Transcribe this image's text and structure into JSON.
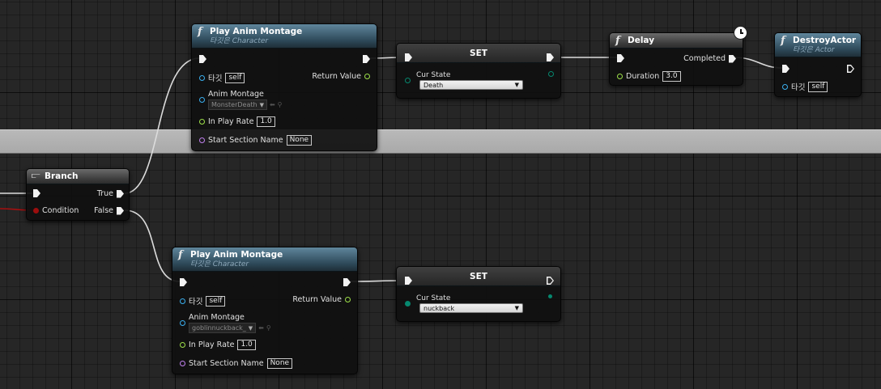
{
  "pins": {
    "target": "타깃",
    "self": "self",
    "anim_montage": "Anim Montage",
    "in_play_rate": "In Play Rate",
    "start_section_name": "Start Section Name",
    "return_value": "Return Value",
    "cur_state": "Cur State",
    "condition": "Condition",
    "true": "True",
    "false": "False",
    "duration": "Duration",
    "completed": "Completed"
  },
  "nodes": {
    "play_montage_top": {
      "title": "Play Anim Montage",
      "subtitle": "타깃은 Character",
      "montage": "MonsterDeath",
      "rate": "1.0",
      "section": "None"
    },
    "set_top": {
      "title": "SET",
      "state": "Death"
    },
    "delay": {
      "title": "Delay",
      "duration": "3.0"
    },
    "destroy": {
      "title": "DestroyActor",
      "subtitle": "타깃은 Actor"
    },
    "branch": {
      "title": "Branch"
    },
    "play_montage_bottom": {
      "title": "Play Anim Montage",
      "subtitle": "타깃은 Character",
      "montage": "goblinnuckback_",
      "rate": "1.0",
      "section": "None"
    },
    "set_bottom": {
      "title": "SET",
      "state": "nuckback"
    }
  },
  "colors": {
    "exec": "#f2f2f2",
    "object_pin": "#3ab0f0",
    "float_pin": "#9ee14a",
    "name_pin": "#c080ee",
    "enum_pin": "#06886f",
    "bool_pin": "#9c0e0e",
    "function_header": "#2d4858"
  },
  "icons": {
    "function": "function-f-icon",
    "branch": "branch-icon",
    "latent": "clock-icon"
  }
}
